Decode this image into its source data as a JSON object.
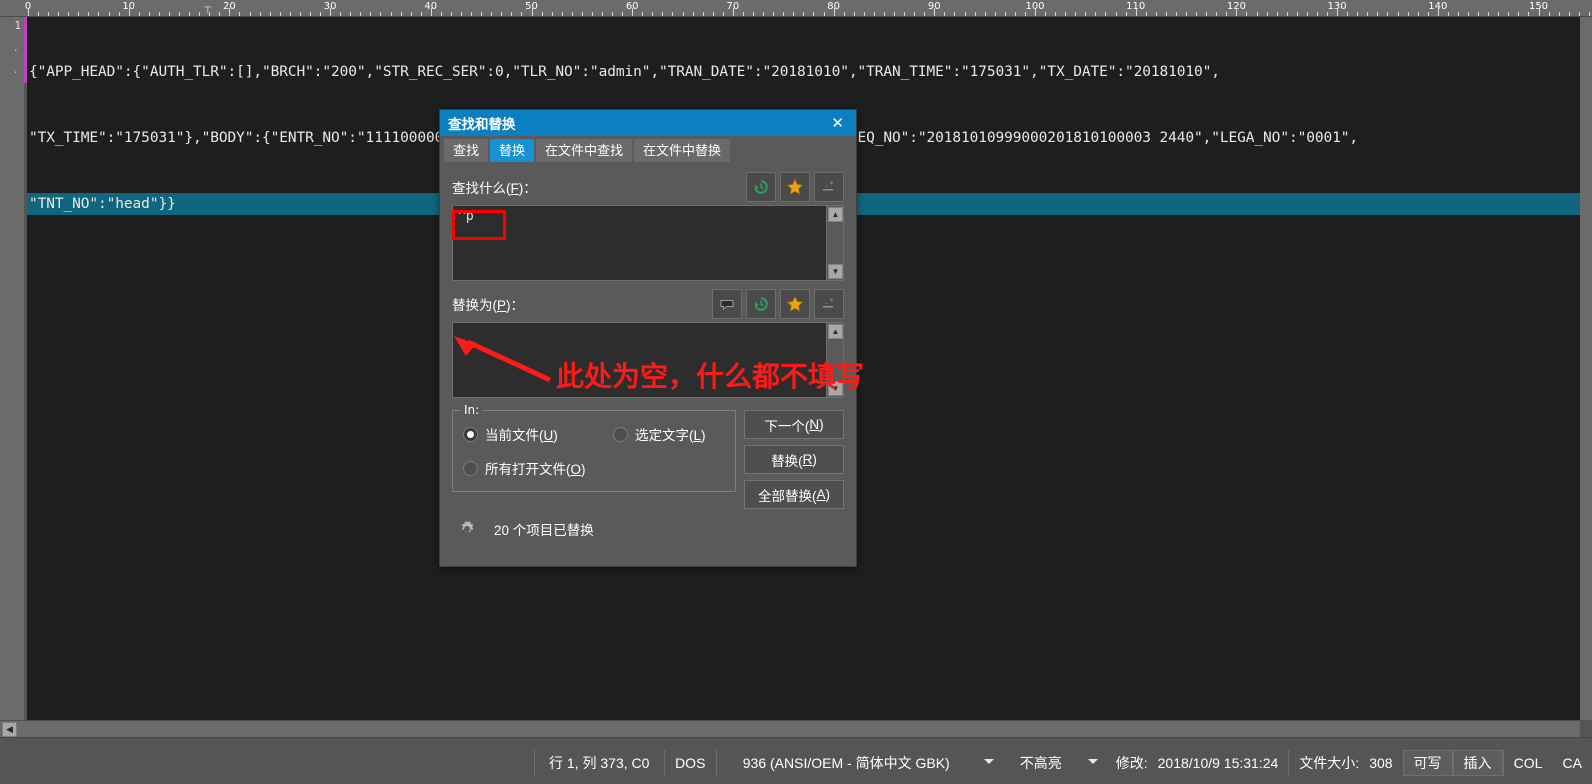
{
  "editor": {
    "ruler_labels": [
      0,
      10,
      20,
      30,
      40,
      50,
      60,
      70,
      80,
      90,
      100,
      110,
      120,
      130,
      140,
      150
    ],
    "line_number": "1",
    "lines": [
      {
        "text": "{\"APP_HEAD\":{\"AUTH_TLR\":[],\"BRCH\":\"200\",\"STR_REC_SER\":0,\"TLR_NO\":\"admin\",\"TRAN_DATE\":\"20181010\",\"TRAN_TIME\":\"175031\",\"TX_DATE\":\"20181010\",",
        "selected": false
      },
      {
        "text": "\"TX_TIME\":\"175031\"},\"BODY\":{\"ENTR_NO\":\"11110000000416\"},\"LOCAL_HEAD\":{\"CHNL_NO\":\"000001\",\"CHNL_SEQ_NO\":\"20181010999000201810100003 2440\",\"LEGA_NO\":\"0001\",",
        "selected": false
      },
      {
        "text": "\"TNT_NO\":\"head\"}}",
        "selected": true
      }
    ]
  },
  "dialog": {
    "title": "查找和替换",
    "close_label": "✕",
    "tabs": [
      {
        "label": "查找",
        "active": false
      },
      {
        "label": "替换",
        "active": true
      },
      {
        "label": "在文件中查找",
        "active": false
      },
      {
        "label": "在文件中替换",
        "active": false
      }
    ],
    "find": {
      "label_main": "查找什么(",
      "label_accel": "F",
      "label_tail": ")：",
      "value": "^p",
      "icons": [
        "history-icon",
        "star-icon",
        "regex-icon"
      ]
    },
    "replace": {
      "label_main": "替换为(",
      "label_accel": "P",
      "label_tail": ")：",
      "value": "",
      "icons": [
        "comment-icon",
        "history-icon",
        "star-icon",
        "regex-icon"
      ]
    },
    "in_group": {
      "legend": "In:",
      "options": [
        {
          "label_main": "当前文件(",
          "accel": "U",
          "label_tail": ")",
          "selected": true
        },
        {
          "label_main": "选定文字(",
          "accel": "L",
          "label_tail": ")",
          "selected": false
        },
        {
          "label_main": "所有打开文件(",
          "accel": "O",
          "label_tail": ")",
          "selected": false
        }
      ]
    },
    "buttons": [
      {
        "label_main": "下一个(",
        "accel": "N",
        "label_tail": ")"
      },
      {
        "label_main": "替换(",
        "accel": "R",
        "label_tail": ")"
      },
      {
        "label_main": "全部替换(",
        "accel": "A",
        "label_tail": ")"
      }
    ],
    "status_text": "20 个项目已替换",
    "gear_icon": "gear-icon"
  },
  "annotations": {
    "note_text": "此处为空，什么都不填写",
    "color": "#ff1a1a"
  },
  "statusbar": {
    "position": "行 1, 列 373, C0",
    "line_ending": "DOS",
    "encoding": "936  (ANSI/OEM - 简体中文 GBK)",
    "highlight": "不高亮",
    "modified_label": "修改:",
    "modified_value": "2018/10/9 15:31:24",
    "filesize_label": "文件大小:",
    "filesize_value": "308",
    "writable": "可写",
    "insert_mode": "插入",
    "col_mode": "COL",
    "caps": "CA"
  },
  "colors": {
    "titlebar": "#0b7fc1",
    "tab_active": "#1790d4",
    "selection": "#11667f",
    "annotation_red": "#ff0000",
    "dialog_bg": "#5a5a5a",
    "editor_bg": "#1e1e1e"
  }
}
